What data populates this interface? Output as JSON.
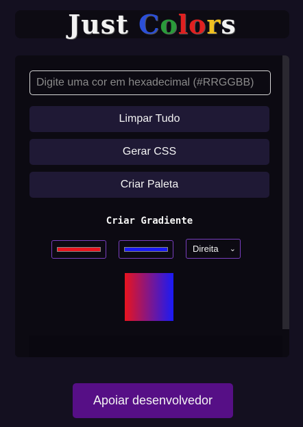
{
  "app": {
    "logo_letters": [
      "J",
      "u",
      "s",
      "t",
      " ",
      "C",
      "o",
      "l",
      "o",
      "r",
      "s"
    ],
    "logo_colors": [
      "#f2f2f2",
      "#f2f2f2",
      "#f2f2f2",
      "#f2f2f2",
      "#f2f2f2",
      "#2b4fd8",
      "#2a9a3a",
      "#e02020",
      "#e02020",
      "#f0c020",
      "#f2f2f2"
    ]
  },
  "input": {
    "placeholder": "Digite uma cor em hexadecimal (#RRGGBB)",
    "value": ""
  },
  "buttons": {
    "clear": "Limpar Tudo",
    "css": "Gerar CSS",
    "palette": "Criar Paleta"
  },
  "gradient": {
    "title": "Criar Gradiente",
    "color1": "#e8141e",
    "color2": "#1a1af5",
    "direction": "Direita",
    "direction_chevron": "⌄"
  },
  "support": {
    "label": "Apoiar desenvolvedor"
  }
}
